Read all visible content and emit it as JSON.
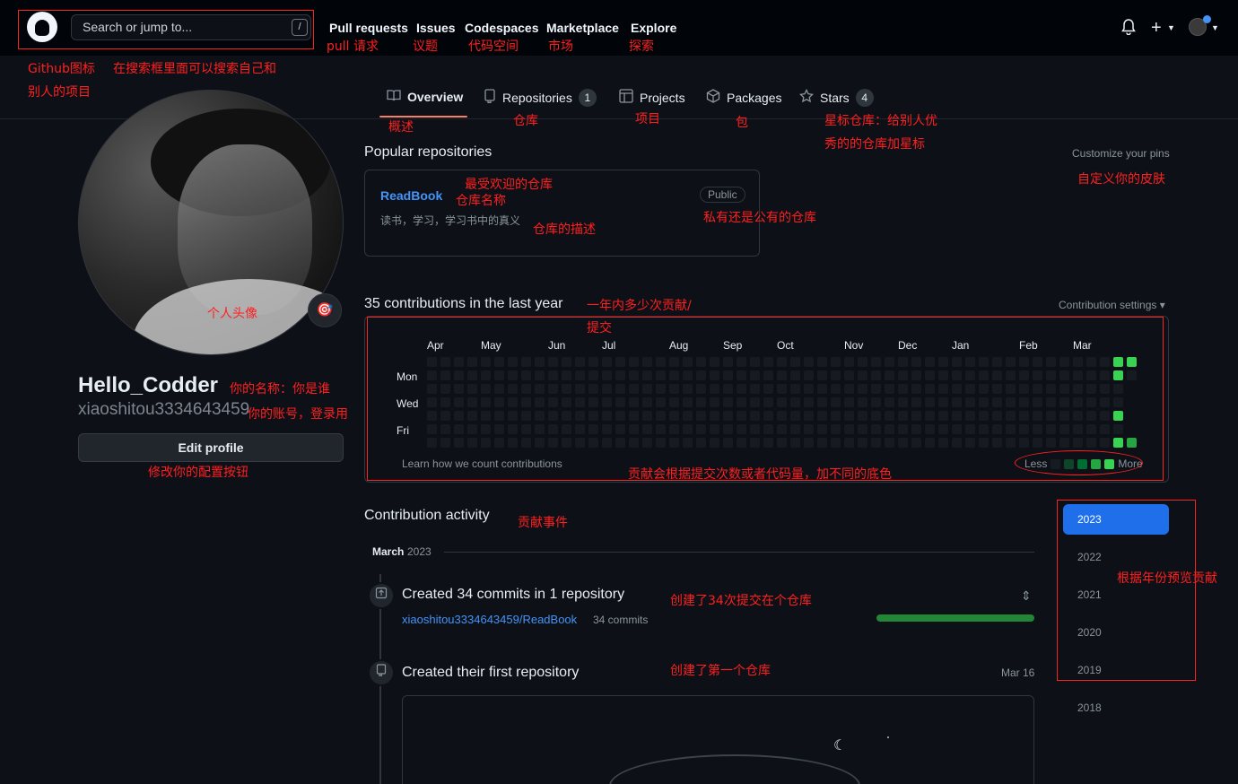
{
  "header": {
    "search_placeholder": "Search or jump to...",
    "search_key": "/",
    "nav": [
      "Pull requests",
      "Issues",
      "Codespaces",
      "Marketplace",
      "Explore"
    ],
    "plus_label": "+"
  },
  "tabs": [
    {
      "label": "Overview",
      "icon": "book-icon"
    },
    {
      "label": "Repositories",
      "icon": "repo-icon",
      "count": "1"
    },
    {
      "label": "Projects",
      "icon": "table-icon"
    },
    {
      "label": "Packages",
      "icon": "package-icon"
    },
    {
      "label": "Stars",
      "icon": "star-icon",
      "count": "4"
    }
  ],
  "profile": {
    "name": "Hello_Codder",
    "login": "xiaoshitou3334643459",
    "edit_button": "Edit profile"
  },
  "popular": {
    "title": "Popular repositories",
    "customize": "Customize your pins",
    "repo": {
      "name": "ReadBook",
      "visibility": "Public",
      "description": "读书，学习，学习书中的真义"
    }
  },
  "contributions": {
    "title": "35 contributions in the last year",
    "settings": "Contribution settings ▾",
    "months": [
      "Apr",
      "May",
      "Jun",
      "Jul",
      "Aug",
      "Sep",
      "Oct",
      "Nov",
      "Dec",
      "Jan",
      "Feb",
      "Mar"
    ],
    "days": [
      "Mon",
      "Wed",
      "Fri"
    ],
    "learn": "Learn how we count contributions",
    "less": "Less",
    "more": "More"
  },
  "activity": {
    "title": "Contribution activity",
    "month_label": "March",
    "month_year": "2023",
    "event1_title": "Created 34 commits in 1 repository",
    "event1_repo": "xiaoshitou3334643459/ReadBook",
    "event1_commits": "34 commits",
    "event2_title": "Created their first repository",
    "event2_date": "Mar 16"
  },
  "years": [
    "2023",
    "2022",
    "2021",
    "2020",
    "2019",
    "2018"
  ],
  "annotations": {
    "pull": "pull 请求",
    "issues": "议题",
    "codespaces": "代码空间",
    "marketplace": "市场",
    "explore": "探索",
    "github_icon": "Github图标",
    "search_line1": "在搜索框里面可以搜索自己和",
    "search_line2": "别人的项目",
    "overview": "概述",
    "repos": "仓库",
    "projects": "项目",
    "packages": "包",
    "stars_line1": "星标仓库：给别人优",
    "stars_line2": "秀的的仓库加星标",
    "popular": "最受欢迎的仓库",
    "repo_name": "仓库名称",
    "repo_desc": "仓库的描述",
    "visibility": "私有还是公有的仓库",
    "customize": "自定义你的皮肤",
    "avatar": "个人头像",
    "name": "你的名称：你是谁",
    "login": "你的账号，登录用",
    "edit": "修改你的配置按钮",
    "contrib_line1": "一年内多少次贡献/",
    "contrib_line2": "提交",
    "color": "贡献会根据提交次数或者代码量，加不同的底色",
    "activity": "贡献事件",
    "commits": "创建了34次提交在个仓库",
    "first_repo": "创建了第一个仓库",
    "years": "根据年份预览贡献"
  },
  "colors": {
    "accent": "#1f6feb",
    "annotation": "#ff1f1f",
    "link": "#4493f8",
    "green": "#39d353"
  }
}
